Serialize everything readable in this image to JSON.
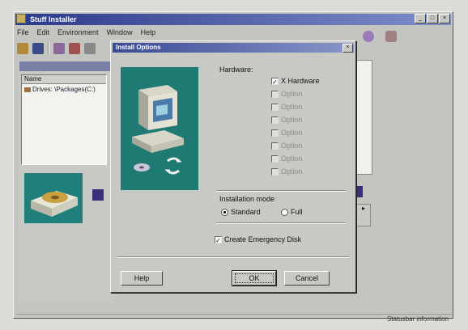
{
  "main_window": {
    "title": "Stuff Installer",
    "buttons": [
      "_",
      "□",
      "×"
    ],
    "menu": [
      "File",
      "Edit",
      "Environment",
      "Window",
      "Help"
    ],
    "status_text": "Statusbar information"
  },
  "left_panel": {
    "list_header": "Name",
    "items": [
      "Drives: \\Packages(C:)"
    ]
  },
  "dialog": {
    "title": "Install Options",
    "close": "×",
    "hardware_label": "Hardware:",
    "options": [
      {
        "label": "X Hardware",
        "checked": true,
        "enabled": true
      },
      {
        "label": "Option",
        "checked": false,
        "enabled": false
      },
      {
        "label": "Option",
        "checked": false,
        "enabled": false
      },
      {
        "label": "Option",
        "checked": false,
        "enabled": false
      },
      {
        "label": "Option",
        "checked": false,
        "enabled": false
      },
      {
        "label": "Option",
        "checked": false,
        "enabled": false
      },
      {
        "label": "Option",
        "checked": false,
        "enabled": false
      },
      {
        "label": "Option",
        "checked": false,
        "enabled": false
      }
    ],
    "mode_label": "Installation mode",
    "mode_options": [
      {
        "label": "Standard",
        "selected": true
      },
      {
        "label": "Full",
        "selected": false
      }
    ],
    "emergency_label": "Create Emergency Disk",
    "emergency_checked": true,
    "help_button": "Help",
    "ok_button": "OK",
    "cancel_button": "Cancel"
  },
  "colors": {
    "title_gradient_start": "#2a3a8c",
    "art_background": "#1e7a72"
  }
}
